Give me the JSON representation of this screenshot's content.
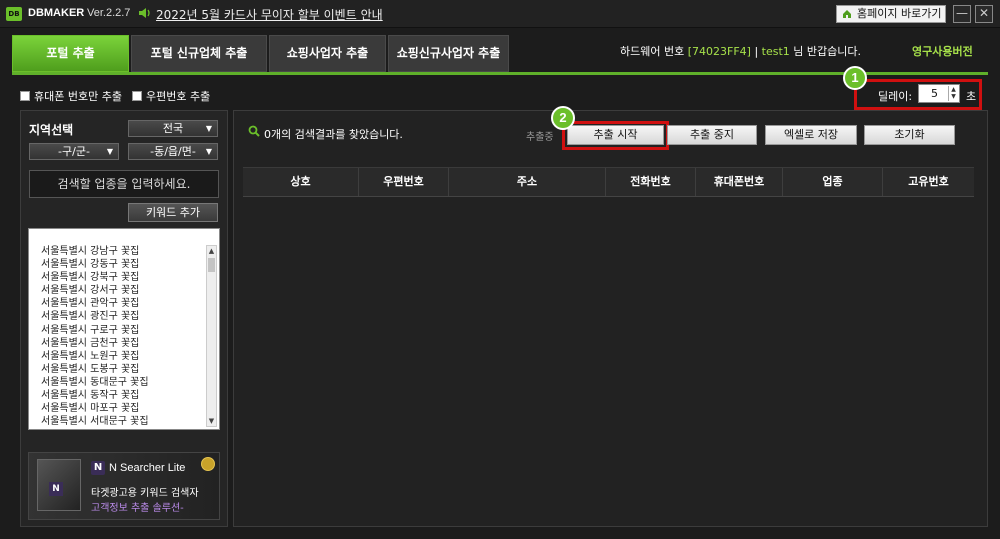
{
  "titlebar": {
    "logo": "DB",
    "app_name": "DBMAKER",
    "version": "Ver.2.2.7",
    "notice": "2022년 5월 카드사 무이자 할부 이벤트 안내",
    "home_button": "홈페이지 바로가기",
    "minimize": "—",
    "close": "✕"
  },
  "tabs": [
    {
      "label": "포털 추출"
    },
    {
      "label": "포털 신규업체 추출"
    },
    {
      "label": "쇼핑사업자 추출"
    },
    {
      "label": "쇼핑신규사업자 추출"
    }
  ],
  "header_info": {
    "hw_label": "하드웨어 번호",
    "hw_id": "[74023FF4]",
    "separator": "|",
    "user": "test1",
    "greeting": "님 반갑습니다.",
    "license": "영구사용버전"
  },
  "options": {
    "mobile_only": "휴대폰 번호만 추출",
    "postal": "우편번호 추출",
    "delay_label": "딜레이:",
    "delay_value": "5",
    "delay_unit": "초"
  },
  "badges": {
    "one": "1",
    "two": "2"
  },
  "region": {
    "title": "지역선택",
    "province": "전국",
    "district": "-구/군-",
    "dong": "-동/읍/면-",
    "search_placeholder": "검색할 업종을 입력하세요.",
    "keyword_add": "키워드 추가",
    "keywords": [
      "서울특별시 강남구 꽃집",
      "서울특별시 강동구 꽃집",
      "서울특별시 강북구 꽃집",
      "서울특별시 강서구 꽃집",
      "서울특별시 관악구 꽃집",
      "서울특별시 광진구 꽃집",
      "서울특별시 구로구 꽃집",
      "서울특별시 금천구 꽃집",
      "서울특별시 노원구 꽃집",
      "서울특별시 도봉구 꽃집",
      "서울특별시 동대문구 꽃집",
      "서울특별시 동작구 꽃집",
      "서울특별시 마포구 꽃집",
      "서울특별시 서대문구 꽃집"
    ]
  },
  "ad": {
    "brand": "N Searcher Lite",
    "line1": "타겟광고용 키워드 검색자",
    "line2": "고객정보 추출 솔루션-"
  },
  "main": {
    "result_text": "0개의 검색결과를 찾았습니다.",
    "status_text": "추출중",
    "buttons": {
      "start": "추출 시작",
      "stop": "추출 중지",
      "save_excel": "엑셀로 저장",
      "reset": "초기화"
    },
    "columns": [
      "상호",
      "우편번호",
      "주소",
      "전화번호",
      "휴대폰번호",
      "업종",
      "고유번호"
    ]
  }
}
